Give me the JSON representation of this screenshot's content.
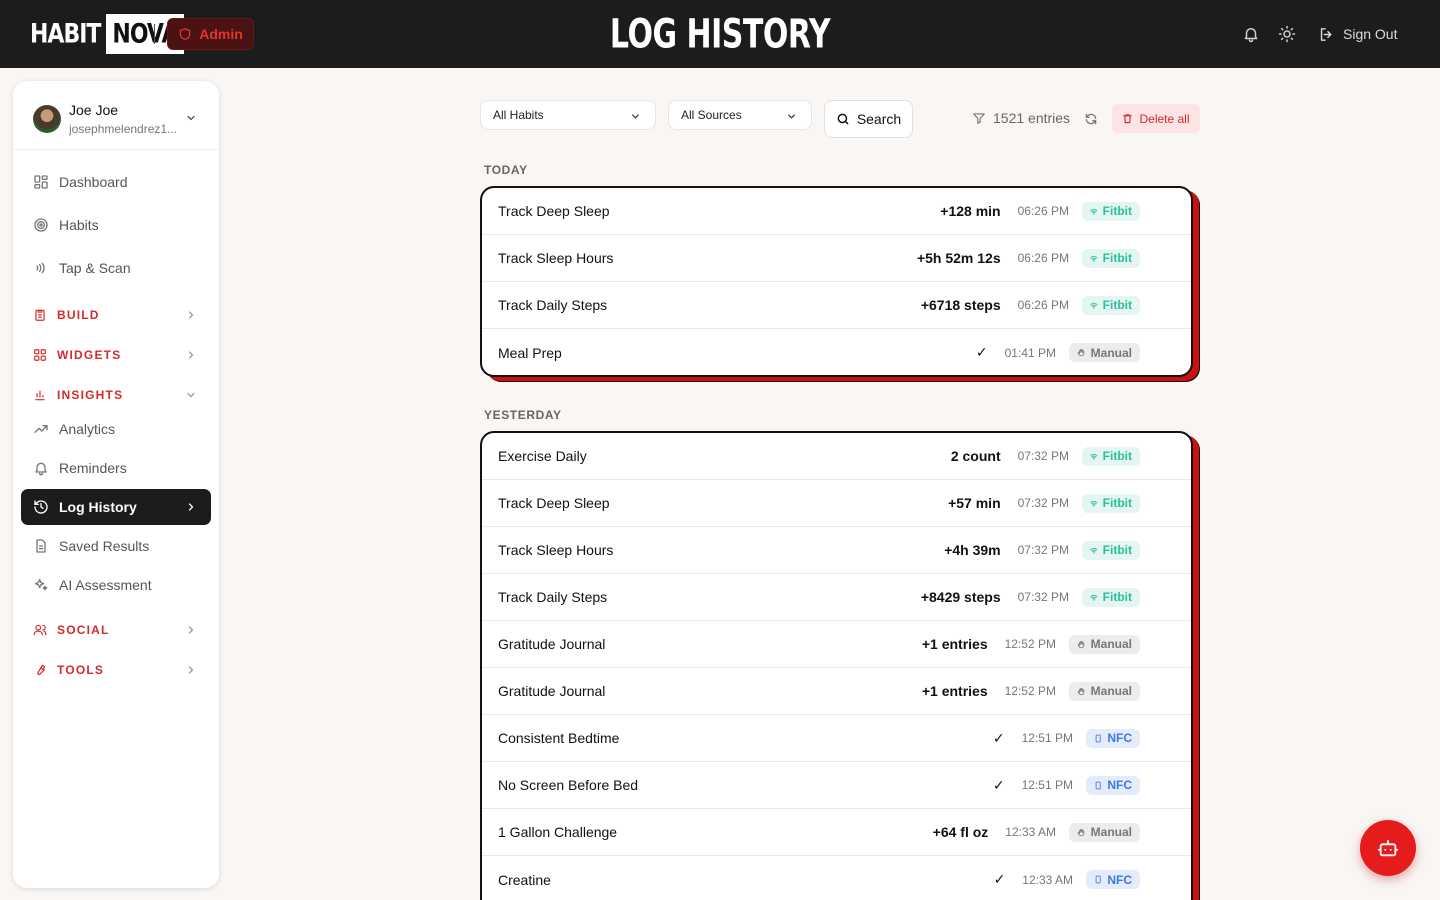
{
  "header": {
    "logo_left": "HABIT",
    "logo_right": "NOVA",
    "admin_label": "Admin",
    "title": "LOG HISTORY",
    "sign_out_label": "Sign Out",
    "icons": [
      "bell-icon",
      "sun-icon",
      "sign-out-icon"
    ]
  },
  "user": {
    "name": "Joe Joe",
    "email": "josephmelendrez1..."
  },
  "sidebar": {
    "items": [
      {
        "label": "Dashboard",
        "icon": "grid-icon"
      },
      {
        "label": "Habits",
        "icon": "target-icon"
      },
      {
        "label": "Tap & Scan",
        "icon": "nfc-waves-icon"
      }
    ],
    "sections": [
      {
        "label": "BUILD",
        "icon": "clipboard-icon"
      },
      {
        "label": "WIDGETS",
        "icon": "widgets-icon"
      },
      {
        "label": "INSIGHTS",
        "icon": "bar-chart-icon"
      }
    ],
    "insights_items": [
      {
        "label": "Analytics",
        "icon": "trend-icon"
      },
      {
        "label": "Reminders",
        "icon": "bell-icon"
      },
      {
        "label": "Log History",
        "icon": "history-icon"
      },
      {
        "label": "Saved Results",
        "icon": "document-icon"
      },
      {
        "label": "AI Assessment",
        "icon": "sparkles-icon"
      }
    ],
    "bottom_sections": [
      {
        "label": "SOCIAL",
        "icon": "users-icon"
      },
      {
        "label": "TOOLS",
        "icon": "wrench-icon"
      }
    ]
  },
  "filters": {
    "habit_select": "All Habits",
    "source_select": "All Sources",
    "search_label": "Search",
    "entries_count": "1521 entries",
    "delete_all_label": "Delete all"
  },
  "groups": [
    {
      "label": "TODAY",
      "rows": [
        {
          "name": "Track Deep Sleep",
          "value": "+128 min",
          "time": "06:26 PM",
          "source": "Fitbit",
          "kind": "fitbit"
        },
        {
          "name": "Track Sleep Hours",
          "value": "+5h 52m 12s",
          "time": "06:26 PM",
          "source": "Fitbit",
          "kind": "fitbit"
        },
        {
          "name": "Track Daily Steps",
          "value": "+6718 steps",
          "time": "06:26 PM",
          "source": "Fitbit",
          "kind": "fitbit"
        },
        {
          "name": "Meal Prep",
          "value": "✓",
          "time": "01:41 PM",
          "source": "Manual",
          "kind": "manual"
        }
      ]
    },
    {
      "label": "YESTERDAY",
      "rows": [
        {
          "name": "Exercise Daily",
          "value": "2 count",
          "time": "07:32 PM",
          "source": "Fitbit",
          "kind": "fitbit"
        },
        {
          "name": "Track Deep Sleep",
          "value": "+57 min",
          "time": "07:32 PM",
          "source": "Fitbit",
          "kind": "fitbit"
        },
        {
          "name": "Track Sleep Hours",
          "value": "+4h 39m",
          "time": "07:32 PM",
          "source": "Fitbit",
          "kind": "fitbit"
        },
        {
          "name": "Track Daily Steps",
          "value": "+8429 steps",
          "time": "07:32 PM",
          "source": "Fitbit",
          "kind": "fitbit"
        },
        {
          "name": "Gratitude Journal",
          "value": "+1 entries",
          "time": "12:52 PM",
          "source": "Manual",
          "kind": "manual"
        },
        {
          "name": "Gratitude Journal",
          "value": "+1 entries",
          "time": "12:52 PM",
          "source": "Manual",
          "kind": "manual"
        },
        {
          "name": "Consistent Bedtime",
          "value": "✓",
          "time": "12:51 PM",
          "source": "NFC",
          "kind": "nfc"
        },
        {
          "name": "No Screen Before Bed",
          "value": "✓",
          "time": "12:51 PM",
          "source": "NFC",
          "kind": "nfc"
        },
        {
          "name": "1 Gallon Challenge",
          "value": "+64 fl oz",
          "time": "12:33 AM",
          "source": "Manual",
          "kind": "manual"
        },
        {
          "name": "Creatine",
          "value": "✓",
          "time": "12:33 AM",
          "source": "NFC",
          "kind": "nfc"
        }
      ]
    }
  ],
  "fab_icon": "robot-icon",
  "colors": {
    "accent_red": "#e61b1b",
    "fitbit": "#2cbf9b",
    "nfc": "#3f78e0",
    "manual": "#777777",
    "topbar": "#1c1c1c"
  }
}
